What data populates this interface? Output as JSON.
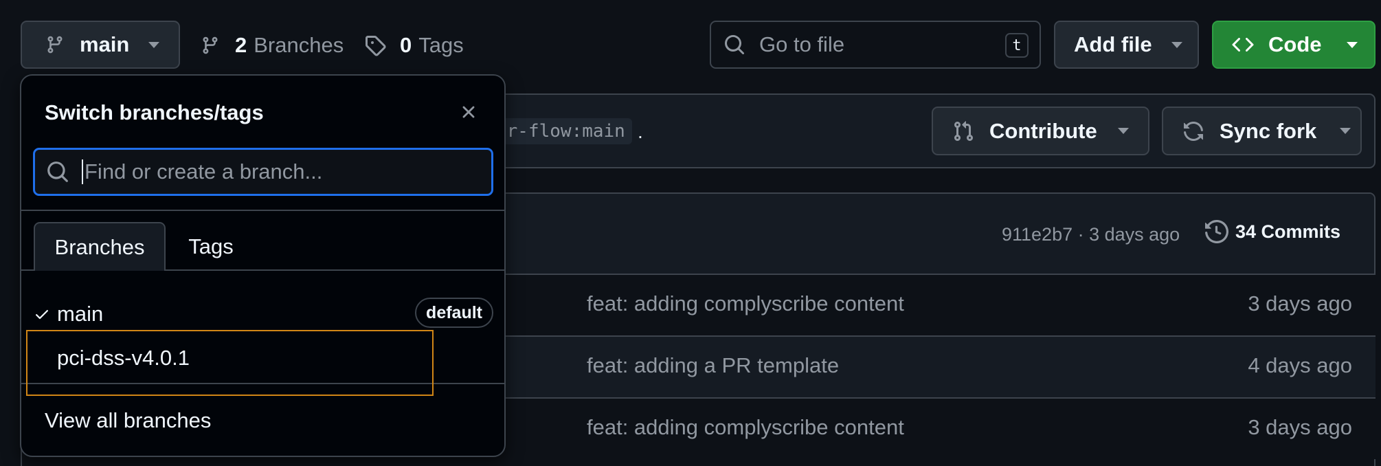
{
  "toolbar": {
    "branch_button_label": "main",
    "branches_count": "2",
    "branches_label": "Branches",
    "tags_count": "0",
    "tags_label": "Tags",
    "go_to_file_placeholder": "Go to file",
    "go_to_file_shortcut": "t",
    "add_file_label": "Add file",
    "code_label": "Code",
    "code_color": "#238636"
  },
  "fork_bar": {
    "branch_ref": "or-flow:main",
    "trailing": ".",
    "contribute_label": "Contribute",
    "sync_fork_label": "Sync fork"
  },
  "commit_header": {
    "hash_and_time": "911e2b7 · 3 days ago",
    "commits_label": "34 Commits"
  },
  "files": [
    {
      "message": "feat: adding complyscribe content",
      "time": "3 days ago"
    },
    {
      "message": "feat: adding a PR template",
      "time": "4 days ago"
    },
    {
      "message": "feat: adding complyscribe content",
      "time": "3 days ago"
    }
  ],
  "popover": {
    "title": "Switch branches/tags",
    "search_placeholder": "Find or create a branch...",
    "tabs": [
      "Branches",
      "Tags"
    ],
    "active_tab": "Branches",
    "branches": [
      {
        "name": "main",
        "badge": "default",
        "selected": true
      },
      {
        "name": "pci-dss-v4.0.1",
        "badge": "",
        "selected": false
      }
    ],
    "view_all_label": "View all branches",
    "highlight_color": "#d18616"
  }
}
